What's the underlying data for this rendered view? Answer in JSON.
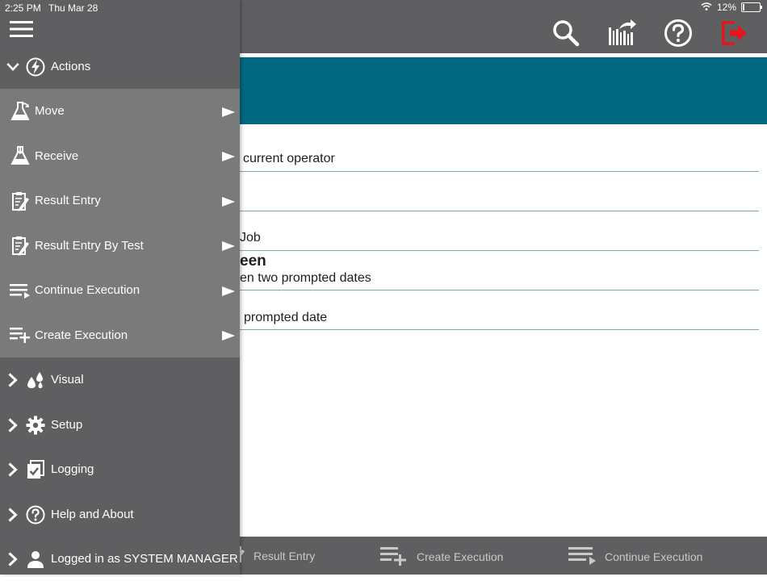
{
  "status_bar": {
    "time": "2:25 PM",
    "date": "Thu Mar 28",
    "battery": "12%",
    "battery_level": 0.12,
    "icons": [
      "wifi-icon",
      "battery-icon"
    ]
  },
  "toolbar": {
    "icons": [
      "search-icon",
      "barcode-share-icon",
      "help-icon",
      "logout-icon"
    ],
    "logout_color": "#e8141b"
  },
  "colors": {
    "banner": "#006880",
    "bars": "#5f5f61",
    "drawer_sublist": "#7a7a7a"
  },
  "content": {
    "rows": [
      {
        "text": "current operator"
      },
      {
        "text": ""
      },
      {
        "text": "Job"
      },
      {
        "heading": "een",
        "text": "en two prompted dates"
      },
      {
        "text": "prompted date"
      }
    ]
  },
  "bottom_bar": {
    "items": [
      {
        "label": "Result Entry",
        "icon": "result-entry-icon"
      },
      {
        "label": "Create Execution",
        "icon": "create-execution-icon"
      },
      {
        "label": "Continue Execution",
        "icon": "continue-execution-icon"
      }
    ]
  },
  "drawer": {
    "menu_icon": "hamburger-icon",
    "actions": {
      "label": "Actions",
      "icon": "lightning-icon",
      "expanded": true,
      "items": [
        {
          "label": "Move",
          "icon": "flask-icon"
        },
        {
          "label": "Receive",
          "icon": "flask-icon"
        },
        {
          "label": "Result Entry",
          "icon": "clipboard-edit-icon"
        },
        {
          "label": "Result Entry By Test",
          "icon": "clipboard-edit-icon"
        },
        {
          "label": "Continue Execution",
          "icon": "list-arrow-icon"
        },
        {
          "label": "Create Execution",
          "icon": "list-plus-icon"
        }
      ]
    },
    "sections": [
      {
        "label": "Visual",
        "icon": "droplets-icon"
      },
      {
        "label": "Setup",
        "icon": "gear-icon"
      },
      {
        "label": "Logging",
        "icon": "log-check-icon"
      },
      {
        "label": "Help and About",
        "icon": "help-icon"
      },
      {
        "label": "Logged in as SYSTEM MANAGER",
        "icon": "user-icon"
      }
    ]
  }
}
